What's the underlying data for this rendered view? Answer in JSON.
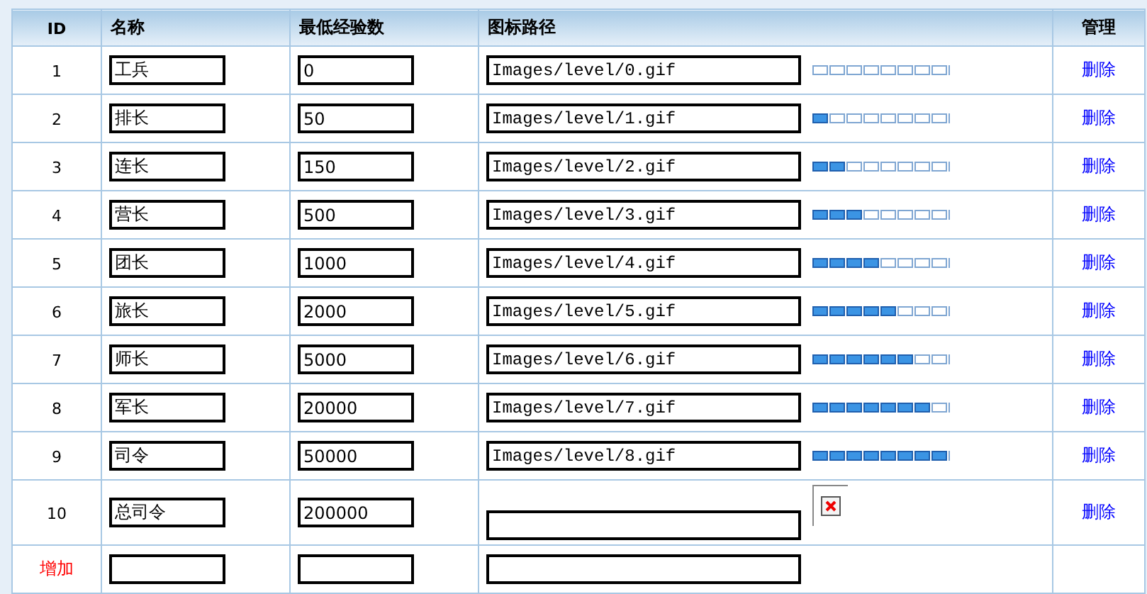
{
  "table": {
    "columns": [
      "ID",
      "名称",
      "最低经验数",
      "图标路径",
      "管理"
    ],
    "rows": [
      {
        "id": "1",
        "name": "工兵",
        "exp": "0",
        "path": "Images/level/0.gif",
        "icon": {
          "kind": "bar",
          "level": 0
        },
        "action": "删除"
      },
      {
        "id": "2",
        "name": "排长",
        "exp": "50",
        "path": "Images/level/1.gif",
        "icon": {
          "kind": "bar",
          "level": 0.125
        },
        "action": "删除"
      },
      {
        "id": "3",
        "name": "连长",
        "exp": "150",
        "path": "Images/level/2.gif",
        "icon": {
          "kind": "bar",
          "level": 0.25
        },
        "action": "删除"
      },
      {
        "id": "4",
        "name": "营长",
        "exp": "500",
        "path": "Images/level/3.gif",
        "icon": {
          "kind": "bar",
          "level": 0.375
        },
        "action": "删除"
      },
      {
        "id": "5",
        "name": "团长",
        "exp": "1000",
        "path": "Images/level/4.gif",
        "icon": {
          "kind": "bar",
          "level": 0.5
        },
        "action": "删除"
      },
      {
        "id": "6",
        "name": "旅长",
        "exp": "2000",
        "path": "Images/level/5.gif",
        "icon": {
          "kind": "bar",
          "level": 0.625
        },
        "action": "删除"
      },
      {
        "id": "7",
        "name": "师长",
        "exp": "5000",
        "path": "Images/level/6.gif",
        "icon": {
          "kind": "bar",
          "level": 0.75
        },
        "action": "删除"
      },
      {
        "id": "8",
        "name": "军长",
        "exp": "20000",
        "path": "Images/level/7.gif",
        "icon": {
          "kind": "bar",
          "level": 0.875
        },
        "action": "删除"
      },
      {
        "id": "9",
        "name": "司令",
        "exp": "50000",
        "path": "Images/level/8.gif",
        "icon": {
          "kind": "bar",
          "level": 1
        },
        "action": "删除"
      },
      {
        "id": "10",
        "name": "总司令",
        "exp": "200000",
        "icon": {
          "kind": "broken"
        },
        "action": "删除"
      }
    ]
  },
  "add_row": {
    "label": "增加"
  }
}
